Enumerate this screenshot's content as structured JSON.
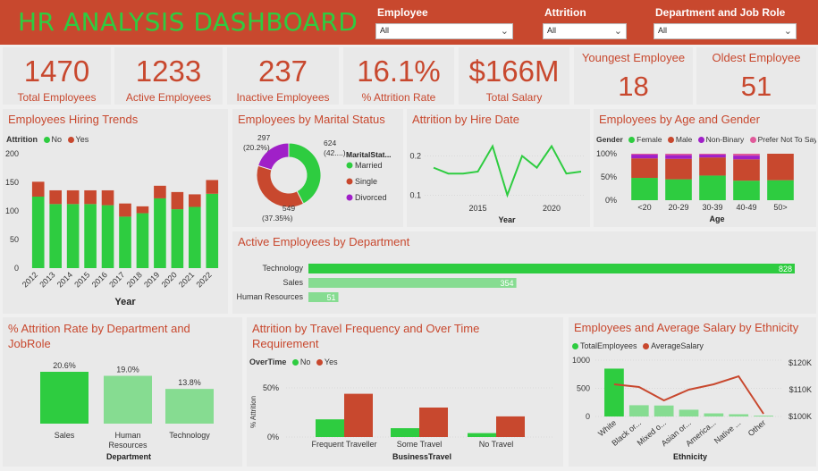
{
  "header": {
    "title": "HR ANALYSIS DASHBOARD",
    "filters": [
      {
        "label": "Employee",
        "value": "All"
      },
      {
        "label": "Attrition",
        "value": "All"
      },
      {
        "label": "Department and Job Role",
        "value": "All"
      }
    ]
  },
  "kpis": [
    {
      "value": "1470",
      "label": "Total Employees"
    },
    {
      "value": "1233",
      "label": "Active Employees"
    },
    {
      "value": "237",
      "label": "Inactive Employees"
    },
    {
      "value": "16.1%",
      "label": "% Attrition Rate"
    },
    {
      "value": "$166M",
      "label": "Total Salary"
    },
    {
      "value": "18",
      "label": "Youngest Employee"
    },
    {
      "value": "51",
      "label": "Oldest Employee"
    }
  ],
  "colors": {
    "green": "#2ecc40",
    "red": "#c8482e",
    "lightgreen": "#86dc91",
    "purple": "#a020c8",
    "pink": "#e05a9a",
    "blue": "#2b7bd8"
  },
  "chart_data": [
    {
      "id": "hiring",
      "type": "bar",
      "title": "Employees Hiring Trends",
      "legend_title": "Attrition",
      "xlabel": "Year",
      "categories": [
        "2012",
        "2013",
        "2014",
        "2015",
        "2016",
        "2017",
        "2018",
        "2019",
        "2020",
        "2021",
        "2022"
      ],
      "series": [
        {
          "name": "No",
          "values": [
            125,
            112,
            112,
            112,
            110,
            90,
            96,
            122,
            103,
            107,
            130
          ]
        },
        {
          "name": "Yes",
          "values": [
            26,
            24,
            24,
            24,
            26,
            23,
            12,
            22,
            30,
            22,
            24
          ]
        }
      ],
      "ylim": [
        0,
        200
      ],
      "yticks": [
        "0",
        "50",
        "100",
        "150",
        "200"
      ]
    },
    {
      "id": "marital",
      "type": "pie",
      "title": "Employees by Marital Status",
      "legend_title": "MaritalStat...",
      "categories": [
        "Married",
        "Single",
        "Divorced"
      ],
      "values": [
        624,
        549,
        297
      ],
      "labels": [
        "624",
        "(42....)",
        "549",
        "(37.35%)",
        "297",
        "(20.2%)"
      ]
    },
    {
      "id": "hiredate",
      "type": "line",
      "title": "Attrition by Hire Date",
      "xlabel": "Year",
      "x": [
        2012,
        2013,
        2014,
        2015,
        2016,
        2017,
        2018,
        2019,
        2020,
        2021,
        2022
      ],
      "values": [
        0.17,
        0.155,
        0.155,
        0.16,
        0.225,
        0.1,
        0.2,
        0.17,
        0.225,
        0.155,
        0.16
      ],
      "ylim": [
        0.08,
        0.24
      ],
      "yticks": [
        "0.1",
        "0.2"
      ],
      "xticks": [
        "2015",
        "2020"
      ]
    },
    {
      "id": "agegender",
      "type": "bar",
      "title": "Employees by Age and Gender",
      "legend_title": "Gender",
      "xlabel": "Age",
      "categories": [
        "<20",
        "20-29",
        "30-39",
        "40-49",
        "50>"
      ],
      "series": [
        {
          "name": "Female",
          "values": [
            48,
            45,
            53,
            42,
            43
          ]
        },
        {
          "name": "Male",
          "values": [
            42,
            44,
            39,
            46,
            57
          ]
        },
        {
          "name": "Non-Binary",
          "values": [
            8,
            8,
            6,
            8,
            0
          ]
        },
        {
          "name": "Prefer Not To Say",
          "values": [
            2,
            3,
            2,
            4,
            0
          ]
        }
      ],
      "ylim": [
        0,
        100
      ],
      "yticks": [
        "0%",
        "50%",
        "100%"
      ]
    },
    {
      "id": "activedept",
      "type": "bar",
      "title": "Active Employees by Department",
      "categories": [
        "Technology",
        "Sales",
        "Human Resources"
      ],
      "values": [
        828,
        354,
        51
      ],
      "value_labels": [
        "828",
        "354",
        "51"
      ]
    },
    {
      "id": "attritiondept",
      "type": "bar",
      "title": "% Attrition Rate by Department and JobRole",
      "xlabel": "Department",
      "categories": [
        "Sales",
        "Human Resources",
        "Technology"
      ],
      "values": [
        20.6,
        19.0,
        13.8
      ],
      "value_labels": [
        "20.6%",
        "19.0%",
        "13.8%"
      ]
    },
    {
      "id": "travel",
      "type": "bar",
      "title": "Attrition by Travel Frequency and Over Time Requirement",
      "legend_title": "OverTime",
      "xlabel": "BusinessTravel",
      "ylabel": "% Attrition",
      "categories": [
        "Frequent Traveller",
        "Some Travel",
        "No Travel"
      ],
      "series": [
        {
          "name": "No",
          "values": [
            18,
            9,
            4
          ]
        },
        {
          "name": "Yes",
          "values": [
            44,
            30,
            21
          ]
        }
      ],
      "ylim": [
        0,
        60
      ],
      "yticks": [
        "0%",
        "50%"
      ]
    },
    {
      "id": "ethnicity",
      "type": "bar",
      "title": "Employees and Average Salary by Ethnicity",
      "xlabel": "Ethnicity",
      "categories": [
        "White",
        "Black or...",
        "Mixed o...",
        "Asian or...",
        "America...",
        "Native ...",
        "Other"
      ],
      "series": [
        {
          "name": "TotalEmployees",
          "values": [
            850,
            200,
            195,
            120,
            55,
            40,
            15
          ]
        },
        {
          "name": "AverageSalary",
          "values": [
            112000,
            111000,
            106000,
            110000,
            112000,
            115000,
            101000
          ]
        }
      ],
      "ylim": [
        0,
        1000
      ],
      "yticks": [
        "0",
        "500",
        "1000"
      ],
      "y2ticks": [
        "$100K",
        "$110K",
        "$120K"
      ],
      "y2lim": [
        100000,
        121000
      ]
    }
  ]
}
